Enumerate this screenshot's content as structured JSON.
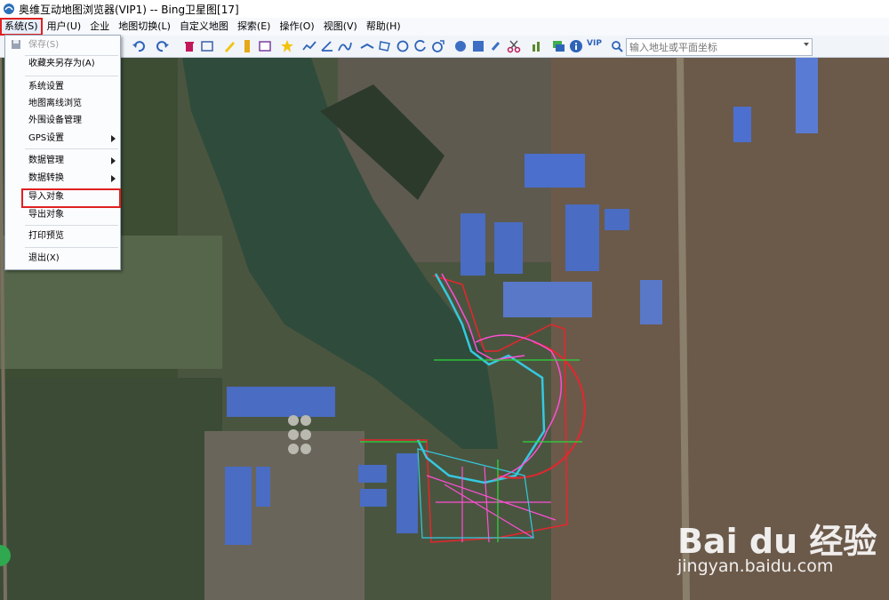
{
  "window": {
    "title": "奥维互动地图浏览器(VIP1) -- Bing卫星图[17]"
  },
  "menubar": [
    {
      "id": "system",
      "label": "系统(S)"
    },
    {
      "id": "user",
      "label": "用户(U)"
    },
    {
      "id": "enterprise",
      "label": "企业"
    },
    {
      "id": "mapswitch",
      "label": "地图切换(L)"
    },
    {
      "id": "custommap",
      "label": "自定义地图"
    },
    {
      "id": "search",
      "label": "探索(E)"
    },
    {
      "id": "operate",
      "label": "操作(O)"
    },
    {
      "id": "view",
      "label": "视图(V)"
    },
    {
      "id": "help",
      "label": "帮助(H)"
    }
  ],
  "toolbar": {
    "search_placeholder": "输入地址或平面坐标",
    "vip_label": "VIP"
  },
  "system_menu": {
    "items": [
      {
        "label": "保存(S)",
        "disabled": true
      },
      {
        "label": "收藏夹另存为(A)"
      },
      {
        "label": "系统设置"
      },
      {
        "label": "地图离线浏览"
      },
      {
        "label": "外围设备管理"
      },
      {
        "label": "GPS设置",
        "submenu": true
      },
      {
        "label": "数据管理",
        "submenu": true
      },
      {
        "label": "数据转换",
        "submenu": true
      },
      {
        "label": "导入对象",
        "highlighted": true
      },
      {
        "label": "导出对象"
      },
      {
        "label": "打印预览"
      },
      {
        "label": "退出(X)"
      }
    ]
  },
  "watermark": {
    "logo_text": "Bai du 经验",
    "url_text": "jingyan.baidu.com"
  },
  "colors": {
    "highlight_red": "#e02020",
    "annotation_cyan": "#22c7d6",
    "map_bg": "#3f4a3a"
  }
}
